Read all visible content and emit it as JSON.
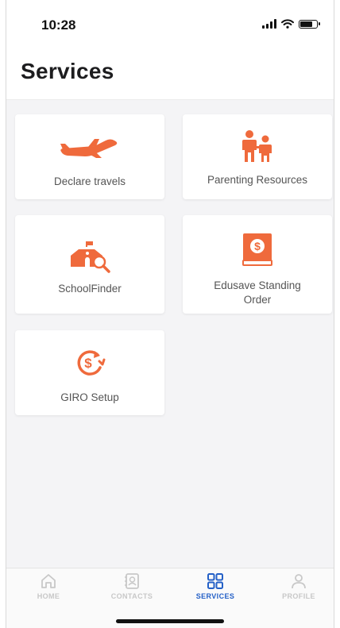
{
  "status": {
    "time": "10:28",
    "battery_level": 0.8
  },
  "page": {
    "title": "Services"
  },
  "colors": {
    "accent": "#ef6a3c",
    "tab_active": "#2460c7",
    "tab_inactive": "#c8c8c8"
  },
  "services": [
    {
      "label": "Declare travels",
      "icon": "airplane-icon"
    },
    {
      "label": "Parenting Resources",
      "icon": "parent-child-icon"
    },
    {
      "label": "SchoolFinder",
      "icon": "school-search-icon"
    },
    {
      "label": "Edusave Standing Order",
      "icon": "dollar-book-icon"
    },
    {
      "label": "GIRO Setup",
      "icon": "dollar-cycle-icon"
    }
  ],
  "tabs": [
    {
      "label": "HOME",
      "icon": "home-icon",
      "active": false
    },
    {
      "label": "CONTACTS",
      "icon": "contacts-icon",
      "active": false
    },
    {
      "label": "SERVICES",
      "icon": "grid-icon",
      "active": true
    },
    {
      "label": "PROFILE",
      "icon": "person-icon",
      "active": false
    }
  ]
}
